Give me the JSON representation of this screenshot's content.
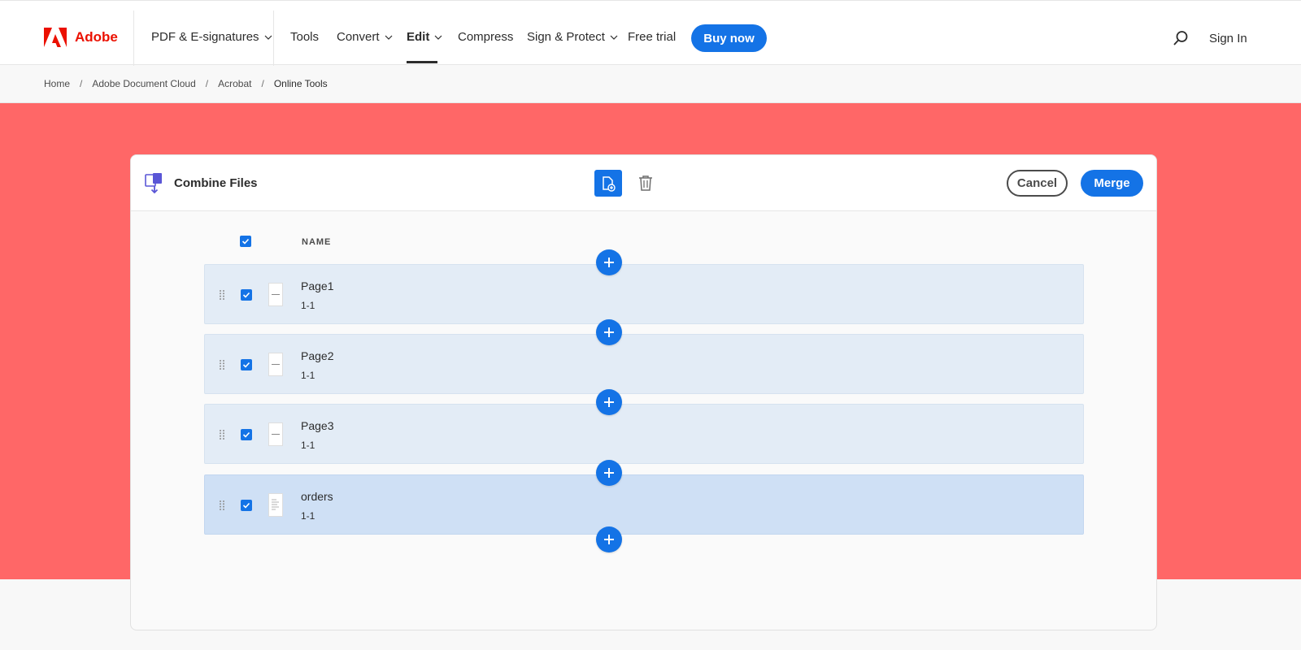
{
  "brand": {
    "name": "Adobe",
    "color": "#eb1000",
    "logo_icon": "adobe-logo-icon"
  },
  "nav": {
    "items": [
      {
        "label": "PDF & E-signatures",
        "has_dropdown": true
      },
      {
        "label": "Tools",
        "has_dropdown": false
      },
      {
        "label": "Convert",
        "has_dropdown": true
      },
      {
        "label": "Edit",
        "has_dropdown": true,
        "active": true
      },
      {
        "label": "Compress",
        "has_dropdown": false
      },
      {
        "label": "Sign & Protect",
        "has_dropdown": true
      },
      {
        "label": "Free trial",
        "has_dropdown": false
      }
    ],
    "buy_label": "Buy now",
    "search_icon": "search-icon",
    "signin_label": "Sign In"
  },
  "breadcrumb": [
    "Home",
    "Adobe Document Cloud",
    "Acrobat",
    "Online Tools"
  ],
  "card": {
    "title": "Combine Files",
    "cancel_label": "Cancel",
    "merge_label": "Merge",
    "column_name": "NAME",
    "files": [
      {
        "name": "Page1",
        "range": "1-1",
        "selected": false
      },
      {
        "name": "Page2",
        "range": "1-1",
        "selected": false
      },
      {
        "name": "Page3",
        "range": "1-1",
        "selected": false
      },
      {
        "name": "orders",
        "range": "1-1",
        "selected": true
      }
    ]
  },
  "colors": {
    "accent": "#1473e6",
    "hero_background": "#ff6767",
    "row_background": "#e3ecf6",
    "row_selected_background": "#cfe0f5"
  }
}
